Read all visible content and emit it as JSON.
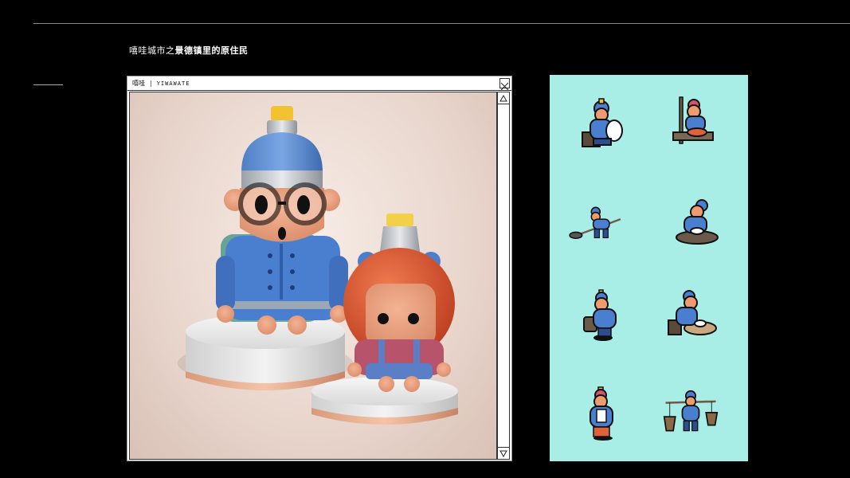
{
  "header": {
    "title_prefix": "嘻哇城市之",
    "title_bold": "景德镇里的原住民"
  },
  "window": {
    "name": "嘻哇",
    "brand": "YIWAWATE"
  },
  "colors": {
    "background": "#000000",
    "panel": "#a8eee6",
    "accent_blue": "#4a7fcf",
    "accent_red": "#d5532f"
  },
  "icons": [
    {
      "name": "potter-painting-vase-icon"
    },
    {
      "name": "potter-at-workbench-icon"
    },
    {
      "name": "worker-shoveling-icon"
    },
    {
      "name": "worker-kneading-clay-icon"
    },
    {
      "name": "worker-carrying-pot-icon"
    },
    {
      "name": "worker-at-basin-icon"
    },
    {
      "name": "child-holding-stack-icon"
    },
    {
      "name": "porter-with-baskets-icon"
    }
  ]
}
